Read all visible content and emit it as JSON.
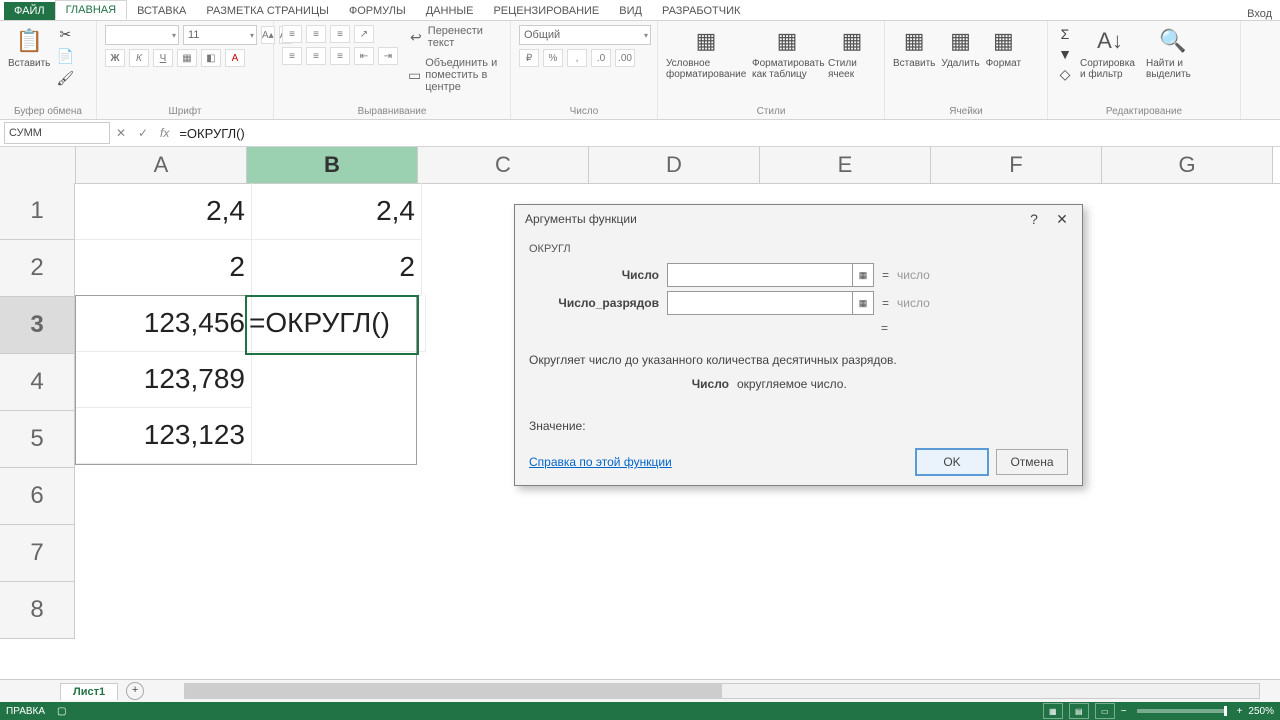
{
  "tabs": {
    "file": "ФАЙЛ",
    "items": [
      "ГЛАВНАЯ",
      "ВСТАВКА",
      "РАЗМЕТКА СТРАНИЦЫ",
      "ФОРМУЛЫ",
      "ДАННЫЕ",
      "РЕЦЕНЗИРОВАНИЕ",
      "ВИД",
      "РАЗРАБОТЧИК"
    ],
    "login": "Вход"
  },
  "ribbon": {
    "clipboard": {
      "label": "Буфер обмена",
      "paste": "Вставить"
    },
    "font": {
      "label": "Шрифт",
      "name": "",
      "size": "11",
      "bold": "Ж",
      "italic": "К",
      "underline": "Ч"
    },
    "align": {
      "label": "Выравнивание",
      "wrap": "Перенести текст",
      "merge": "Объединить и поместить в центре"
    },
    "number": {
      "label": "Число",
      "format": "Общий"
    },
    "styles": {
      "label": "Стили",
      "cond": "Условное форматирование",
      "table": "Форматировать как таблицу",
      "cell": "Стили ячеек"
    },
    "cells": {
      "label": "Ячейки",
      "insert": "Вставить",
      "delete": "Удалить",
      "format": "Формат"
    },
    "editing": {
      "label": "Редактирование",
      "sort": "Сортировка и фильтр",
      "find": "Найти и выделить"
    }
  },
  "fx": {
    "name": "СУММ",
    "formula": "=ОКРУГЛ()"
  },
  "columns": [
    "A",
    "B",
    "C",
    "D",
    "E",
    "F",
    "G"
  ],
  "rows": [
    1,
    2,
    3,
    4,
    5,
    6,
    7,
    8
  ],
  "sheet": {
    "A1": "2,4",
    "B1": "2,4",
    "A2": "2",
    "B2": "2",
    "A3": "123,456",
    "B3": "=ОКРУГЛ()",
    "A4": "123,789",
    "A5": "123,123"
  },
  "dialog": {
    "title": "Аргументы функции",
    "fn": "ОКРУГЛ",
    "arg1": "Число",
    "arg2": "Число_разрядов",
    "hint": "число",
    "eq": "=",
    "desc": "Округляет число до указанного количества десятичных разрядов.",
    "argname": "Число",
    "argdesc": "округляемое число.",
    "value": "Значение:",
    "help": "Справка по этой функции",
    "ok": "OK",
    "cancel": "Отмена",
    "close": "✕",
    "q": "?"
  },
  "sheettab": "Лист1",
  "status": {
    "mode": "ПРАВКА",
    "zoom": "250%"
  }
}
